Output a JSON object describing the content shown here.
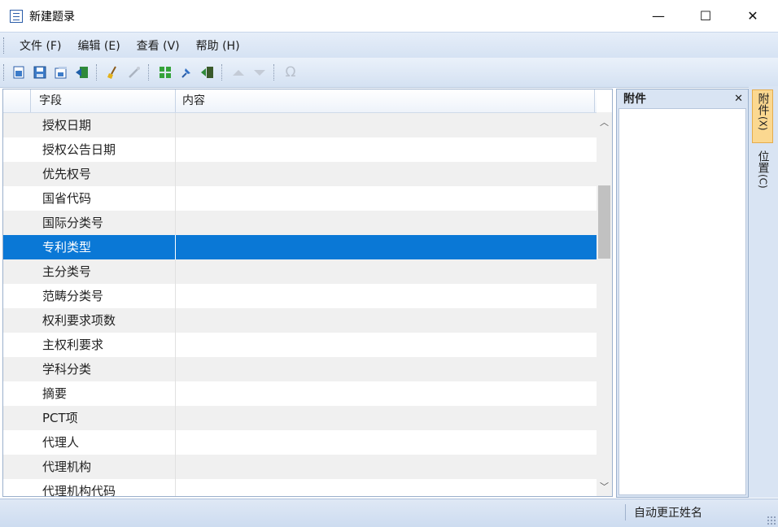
{
  "window": {
    "title": "新建题录",
    "minimize": "—",
    "maximize": "☐",
    "close": "✕"
  },
  "menubar": {
    "items": [
      "文件 (F)",
      "编辑 (E)",
      "查看 (V)",
      "帮助 (H)"
    ]
  },
  "toolbar": {
    "omega": "Ω"
  },
  "grid": {
    "headers": {
      "field": "字段",
      "content": "内容"
    },
    "rows": [
      "授权日期",
      "授权公告日期",
      "优先权号",
      "国省代码",
      "国际分类号",
      "专利类型",
      "主分类号",
      "范畴分类号",
      "权利要求项数",
      "主权利要求",
      "学科分类",
      "摘要",
      "PCT项",
      "代理人",
      "代理机构",
      "代理机构代码"
    ],
    "selected_index": 5
  },
  "attach_panel": {
    "title": "附件",
    "close": "✕"
  },
  "side_tabs": [
    {
      "label": "附件",
      "key": "(X)"
    },
    {
      "label": "位置",
      "key": "(C)"
    }
  ],
  "statusbar": {
    "text": "自动更正姓名"
  },
  "colors": {
    "selection": "#0a78d6",
    "chrome": "#d9e4f3"
  }
}
